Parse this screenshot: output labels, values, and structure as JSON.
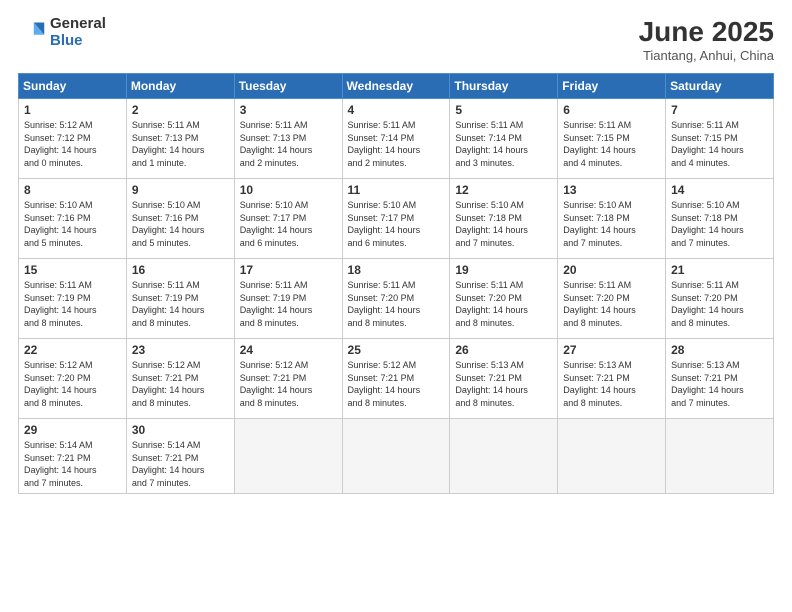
{
  "logo": {
    "general": "General",
    "blue": "Blue"
  },
  "header": {
    "month": "June 2025",
    "location": "Tiantang, Anhui, China"
  },
  "weekdays": [
    "Sunday",
    "Monday",
    "Tuesday",
    "Wednesday",
    "Thursday",
    "Friday",
    "Saturday"
  ],
  "weeks": [
    [
      {
        "day": "1",
        "sunrise": "5:12 AM",
        "sunset": "7:12 PM",
        "daylight": "14 hours and 0 minutes."
      },
      {
        "day": "2",
        "sunrise": "5:11 AM",
        "sunset": "7:13 PM",
        "daylight": "14 hours and 1 minute."
      },
      {
        "day": "3",
        "sunrise": "5:11 AM",
        "sunset": "7:13 PM",
        "daylight": "14 hours and 2 minutes."
      },
      {
        "day": "4",
        "sunrise": "5:11 AM",
        "sunset": "7:14 PM",
        "daylight": "14 hours and 2 minutes."
      },
      {
        "day": "5",
        "sunrise": "5:11 AM",
        "sunset": "7:14 PM",
        "daylight": "14 hours and 3 minutes."
      },
      {
        "day": "6",
        "sunrise": "5:11 AM",
        "sunset": "7:15 PM",
        "daylight": "14 hours and 4 minutes."
      },
      {
        "day": "7",
        "sunrise": "5:11 AM",
        "sunset": "7:15 PM",
        "daylight": "14 hours and 4 minutes."
      }
    ],
    [
      {
        "day": "8",
        "sunrise": "5:10 AM",
        "sunset": "7:16 PM",
        "daylight": "14 hours and 5 minutes."
      },
      {
        "day": "9",
        "sunrise": "5:10 AM",
        "sunset": "7:16 PM",
        "daylight": "14 hours and 5 minutes."
      },
      {
        "day": "10",
        "sunrise": "5:10 AM",
        "sunset": "7:17 PM",
        "daylight": "14 hours and 6 minutes."
      },
      {
        "day": "11",
        "sunrise": "5:10 AM",
        "sunset": "7:17 PM",
        "daylight": "14 hours and 6 minutes."
      },
      {
        "day": "12",
        "sunrise": "5:10 AM",
        "sunset": "7:18 PM",
        "daylight": "14 hours and 7 minutes."
      },
      {
        "day": "13",
        "sunrise": "5:10 AM",
        "sunset": "7:18 PM",
        "daylight": "14 hours and 7 minutes."
      },
      {
        "day": "14",
        "sunrise": "5:10 AM",
        "sunset": "7:18 PM",
        "daylight": "14 hours and 7 minutes."
      }
    ],
    [
      {
        "day": "15",
        "sunrise": "5:11 AM",
        "sunset": "7:19 PM",
        "daylight": "14 hours and 8 minutes."
      },
      {
        "day": "16",
        "sunrise": "5:11 AM",
        "sunset": "7:19 PM",
        "daylight": "14 hours and 8 minutes."
      },
      {
        "day": "17",
        "sunrise": "5:11 AM",
        "sunset": "7:19 PM",
        "daylight": "14 hours and 8 minutes."
      },
      {
        "day": "18",
        "sunrise": "5:11 AM",
        "sunset": "7:20 PM",
        "daylight": "14 hours and 8 minutes."
      },
      {
        "day": "19",
        "sunrise": "5:11 AM",
        "sunset": "7:20 PM",
        "daylight": "14 hours and 8 minutes."
      },
      {
        "day": "20",
        "sunrise": "5:11 AM",
        "sunset": "7:20 PM",
        "daylight": "14 hours and 8 minutes."
      },
      {
        "day": "21",
        "sunrise": "5:11 AM",
        "sunset": "7:20 PM",
        "daylight": "14 hours and 8 minutes."
      }
    ],
    [
      {
        "day": "22",
        "sunrise": "5:12 AM",
        "sunset": "7:20 PM",
        "daylight": "14 hours and 8 minutes."
      },
      {
        "day": "23",
        "sunrise": "5:12 AM",
        "sunset": "7:21 PM",
        "daylight": "14 hours and 8 minutes."
      },
      {
        "day": "24",
        "sunrise": "5:12 AM",
        "sunset": "7:21 PM",
        "daylight": "14 hours and 8 minutes."
      },
      {
        "day": "25",
        "sunrise": "5:12 AM",
        "sunset": "7:21 PM",
        "daylight": "14 hours and 8 minutes."
      },
      {
        "day": "26",
        "sunrise": "5:13 AM",
        "sunset": "7:21 PM",
        "daylight": "14 hours and 8 minutes."
      },
      {
        "day": "27",
        "sunrise": "5:13 AM",
        "sunset": "7:21 PM",
        "daylight": "14 hours and 8 minutes."
      },
      {
        "day": "28",
        "sunrise": "5:13 AM",
        "sunset": "7:21 PM",
        "daylight": "14 hours and 7 minutes."
      }
    ],
    [
      {
        "day": "29",
        "sunrise": "5:14 AM",
        "sunset": "7:21 PM",
        "daylight": "14 hours and 7 minutes."
      },
      {
        "day": "30",
        "sunrise": "5:14 AM",
        "sunset": "7:21 PM",
        "daylight": "14 hours and 7 minutes."
      },
      null,
      null,
      null,
      null,
      null
    ]
  ],
  "labels": {
    "sunrise": "Sunrise:",
    "sunset": "Sunset:",
    "daylight": "Daylight:"
  }
}
